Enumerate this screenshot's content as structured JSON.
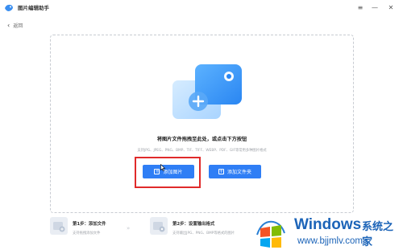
{
  "app": {
    "title": "图片编辑助手"
  },
  "nav": {
    "back_label": "返回"
  },
  "dropzone": {
    "prompt": "将图片文件拖拽至此处，或点击下方按钮",
    "formats": "支持JPG、JPEG、PNG、BMP、TIF、TIFF、WEBP、PDF、GIF等常用多种图片格式",
    "add_image_label": "添加图片",
    "add_folder_label": "添加文件夹"
  },
  "steps": [
    {
      "title": "第1步：添加文件",
      "desc": "支持拖拽添加文件"
    },
    {
      "title": "第2步：设置输出格式",
      "desc": "支持输出JPG、PNG、BMP等格式的图片"
    }
  ],
  "watermark": {
    "brand": "Windows",
    "brand_cn": "系统之家",
    "url": "www.bjjmlv.com"
  },
  "colors": {
    "accent": "#2f7ef5",
    "highlight": "#e02a2a",
    "watermark": "#1c64b8"
  }
}
